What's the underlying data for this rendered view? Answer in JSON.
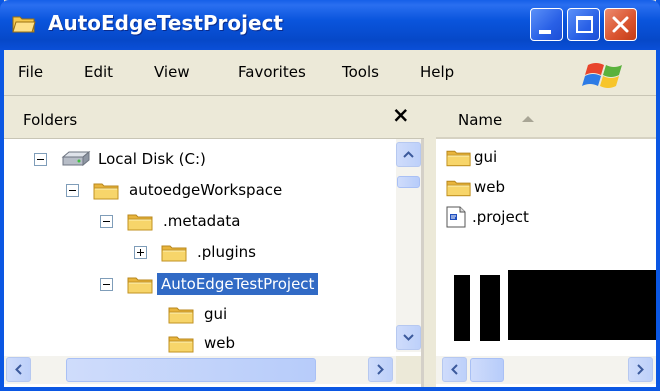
{
  "window": {
    "title": "AutoEdgeTestProject"
  },
  "menu": {
    "items": [
      "File",
      "Edit",
      "View",
      "Favorites",
      "Tools",
      "Help"
    ]
  },
  "folders_pane": {
    "title": "Folders",
    "close_glyph": "×",
    "tree": [
      {
        "label": "Local Disk (C:)",
        "expander": "minus",
        "icon": "hard-disk-icon"
      },
      {
        "label": "autoedgeWorkspace",
        "expander": "minus",
        "icon": "folder-icon"
      },
      {
        "label": ".metadata",
        "expander": "minus",
        "icon": "folder-icon"
      },
      {
        "label": ".plugins",
        "expander": "plus",
        "icon": "folder-icon"
      },
      {
        "label": "AutoEdgeTestProject",
        "expander": "minus",
        "icon": "folder-icon",
        "selected": true
      },
      {
        "label": "gui",
        "icon": "folder-icon"
      },
      {
        "label": "web",
        "icon": "folder-icon"
      }
    ]
  },
  "file_list": {
    "column_header": "Name",
    "sort": "ascending",
    "items": [
      {
        "name": "gui",
        "icon": "folder-icon"
      },
      {
        "name": "web",
        "icon": "folder-icon"
      },
      {
        "name": ".project",
        "icon": "project-file-icon"
      }
    ]
  },
  "colors": {
    "titlebar": "#0a55dd",
    "selection": "#316ac5",
    "folder": "#f3c74c",
    "window_bg": "#ece9d8"
  }
}
